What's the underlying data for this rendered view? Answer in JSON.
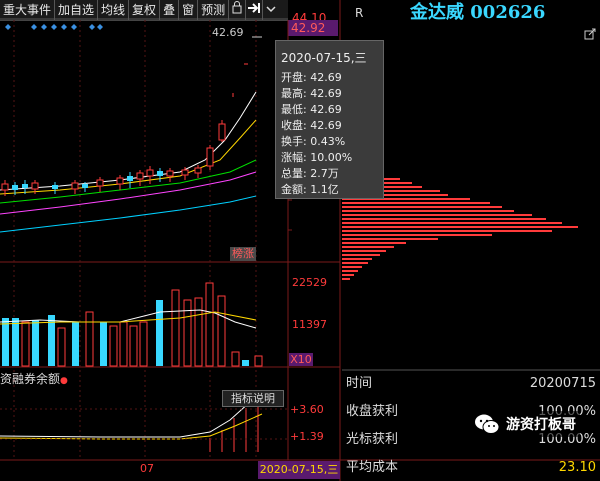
{
  "toolbar": {
    "items": [
      "重大事件",
      "加自选",
      "均线",
      "复权",
      "叠",
      "窗",
      "预测"
    ],
    "lock_icon": "lock-icon",
    "export_icon": "export-icon",
    "more_icon": "more-icon"
  },
  "price_axis": {
    "top_label": "44.10",
    "current_price": "42.92",
    "latest_marker": "42.69",
    "vol_top": "22529",
    "vol_mid": "11397",
    "vol_unit": "X10",
    "ind_top": "+3.60",
    "ind_mid": "+1.39"
  },
  "stock": {
    "name": "金达威",
    "code": "002626",
    "r_label": "R"
  },
  "tooltip": {
    "date": "2020-07-15,三",
    "rows": [
      "开盘: 42.69",
      "最高: 42.69",
      "最低: 42.69",
      "收盘: 42.69",
      "换手: 0.43%",
      "涨幅: 10.00%",
      "总量: 2.7万",
      "金额: 1.1亿"
    ]
  },
  "badges": {
    "bang_zhang": "榜涨",
    "margin_label": "资融券余额",
    "indicator_help": "指标说明"
  },
  "xaxis": {
    "month_label": "07",
    "cursor_date": "2020-07-15,三"
  },
  "stats": [
    {
      "label": "时间",
      "value": "20200715"
    },
    {
      "label": "收盘获利",
      "value": "100.00%"
    },
    {
      "label": "光标获利",
      "value": "100.00%"
    },
    {
      "label": "平均成本",
      "value": "23.10"
    }
  ],
  "watermark": "游资打板哥",
  "colors": {
    "up": "#ff3b3b",
    "down": "#38d8ff",
    "ma5": "#ffffff",
    "ma10": "#ffd700",
    "ma20": "#ff44ff",
    "ma60": "#00e000"
  }
}
